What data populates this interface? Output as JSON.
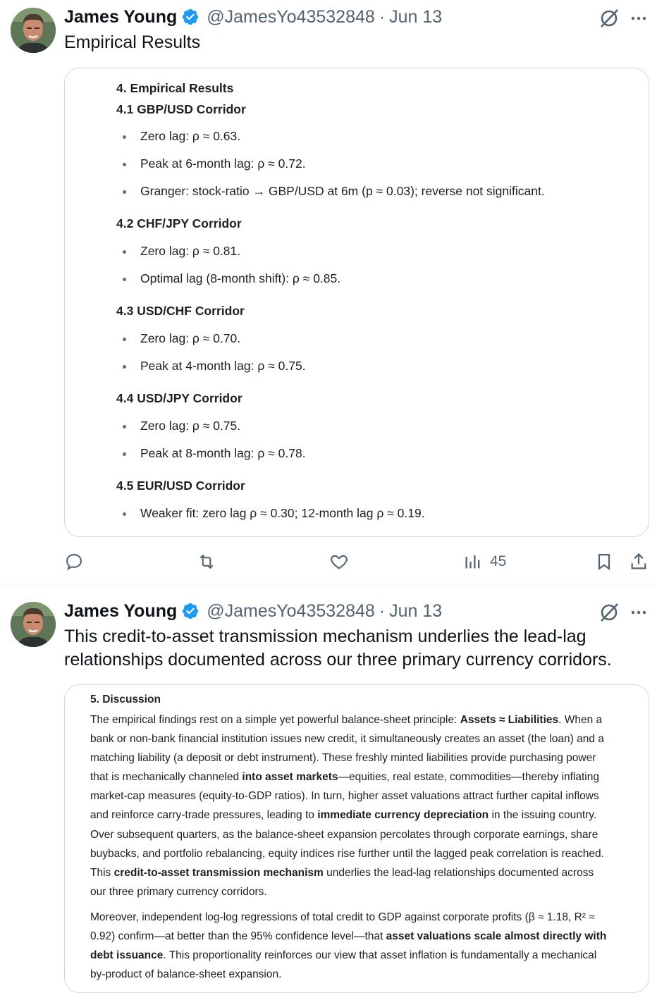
{
  "tweets": [
    {
      "author": {
        "name": "James Young",
        "handle": "@JamesYo43532848",
        "date": "Jun 13",
        "verified": true
      },
      "text": "Empirical Results",
      "media": {
        "heading": "4. Empirical Results",
        "sections": [
          {
            "title": "4.1 GBP/USD Corridor",
            "bullets": [
              "Zero lag: ρ ≈ 0.63.",
              "Peak at 6-month lag: ρ ≈ 0.72.",
              "Granger: stock-ratio → GBP/USD at 6m (p ≈ 0.03); reverse not significant."
            ]
          },
          {
            "title": "4.2 CHF/JPY Corridor",
            "bullets": [
              "Zero lag: ρ ≈ 0.81.",
              "Optimal lag (8-month shift): ρ ≈ 0.85."
            ]
          },
          {
            "title": "4.3 USD/CHF Corridor",
            "bullets": [
              "Zero lag: ρ ≈ 0.70.",
              "Peak at 4-month lag: ρ ≈ 0.75."
            ]
          },
          {
            "title": "4.4 USD/JPY Corridor",
            "bullets": [
              "Zero lag: ρ ≈ 0.75.",
              "Peak at 8-month lag: ρ ≈ 0.78."
            ]
          },
          {
            "title": "4.5 EUR/USD Corridor",
            "bullets": [
              "Weaker fit: zero lag ρ ≈ 0.30; 12-month lag ρ ≈ 0.19."
            ]
          }
        ]
      },
      "actions": {
        "reply": "",
        "retweet": "",
        "like": "",
        "views": "45"
      }
    },
    {
      "author": {
        "name": "James Young",
        "handle": "@JamesYo43532848",
        "date": "Jun 13",
        "verified": true
      },
      "text_line1": "This credit-to-asset transmission mechanism underlies the lead-lag",
      "text_line2": "relationships documented across our three primary currency corridors.",
      "media": {
        "title": "5. Discussion",
        "p1_lines": [
          [
            "The empirical findings rest on a simple yet powerful balance-sheet principle: ",
            "Assets ≈ Liabilities",
            ". When a"
          ],
          [
            "bank or non-bank financial institution issues new credit, it simultaneously creates an asset (the loan) and a",
            "",
            ""
          ],
          [
            "matching liability (a deposit or debt instrument). These freshly minted liabilities provide purchasing power",
            "",
            ""
          ],
          [
            "that is mechanically channeled ",
            "into asset markets",
            "—equities, real estate, commodities—thereby inflating"
          ],
          [
            "market-cap measures (equity-to-GDP ratios). In turn, higher asset valuations attract further capital inflows",
            "",
            ""
          ],
          [
            "and reinforce carry-trade pressures, leading to ",
            "immediate currency depreciation",
            " in the issuing country."
          ],
          [
            "Over subsequent quarters, as the balance-sheet expansion percolates through corporate earnings, share",
            "",
            ""
          ],
          [
            "buybacks, and portfolio rebalancing, equity indices rise further until the lagged peak correlation is reached.",
            "",
            ""
          ],
          [
            "This ",
            "credit-to-asset transmission mechanism",
            " underlies the lead-lag relationships documented across"
          ],
          [
            "our three primary currency corridors.",
            "",
            ""
          ]
        ],
        "p2_lines": [
          [
            "Moreover, independent log-log regressions of total credit to GDP against corporate profits (β ≈ 1.18, R² ≈",
            "",
            ""
          ],
          [
            "0.92) confirm—at better than the 95% confidence level—that ",
            "asset valuations scale almost directly with",
            ""
          ],
          [
            "",
            "debt issuance",
            ". This proportionality reinforces our view that asset inflation is fundamentally a mechanical"
          ],
          [
            "by-product of balance-sheet expansion.",
            "",
            ""
          ]
        ]
      }
    }
  ],
  "colors": {
    "verified": "#1d9bf0",
    "muted": "#536471",
    "text": "#0f1419",
    "border": "#cfd9de"
  }
}
